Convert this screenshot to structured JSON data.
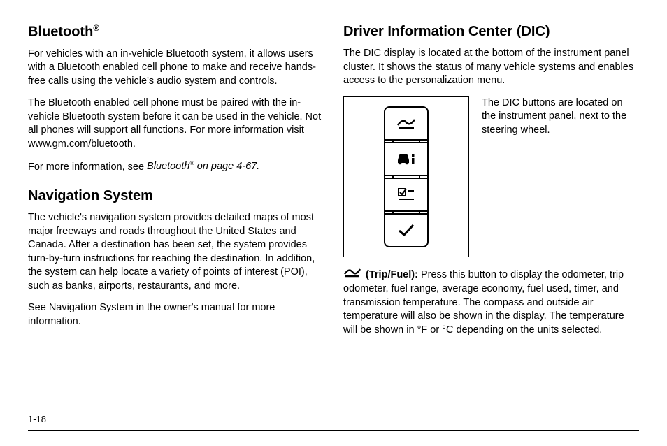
{
  "left": {
    "h1": "Bluetooth",
    "h1_sup": "®",
    "p1": "For vehicles with an in-vehicle Bluetooth system, it allows users with a Bluetooth enabled cell phone to make and receive hands-free calls using the vehicle's audio system and controls.",
    "p2": "The Bluetooth enabled cell phone must be paired with the in-vehicle Bluetooth system before it can be used in the vehicle. Not all phones will support all functions. For more information visit www.gm.com/bluetooth.",
    "p3_a": "For more information, see ",
    "p3_i": "Bluetooth",
    "p3_sup": "®",
    "p3_i2": " on page 4-67.",
    "h2": "Navigation System",
    "p4": "The vehicle's navigation system provides detailed maps of most major freeways and roads throughout the United States and Canada. After a destination has been set, the system provides turn-by-turn instructions for reaching the destination. In addition, the system can help locate a variety of points of interest (POI), such as banks, airports, restaurants, and more.",
    "p5": "See Navigation System in the owner's manual for more information."
  },
  "right": {
    "h1": "Driver Information Center (DIC)",
    "p1": "The DIC display is located at the bottom of the instrument panel cluster. It shows the status of many vehicle systems and enables access to the personalization menu.",
    "figtext": "The DIC buttons are located on the instrument panel, next to the steering wheel.",
    "trip_label": " (Trip/Fuel): ",
    "trip_body": "Press this button to display the odometer, trip odometer, fuel range, average economy, fuel used, timer, and transmission temperature. The compass and outside air temperature will also be shown in the display. The temperature will be shown in °F or °C depending on the units selected."
  },
  "page": "1-18"
}
